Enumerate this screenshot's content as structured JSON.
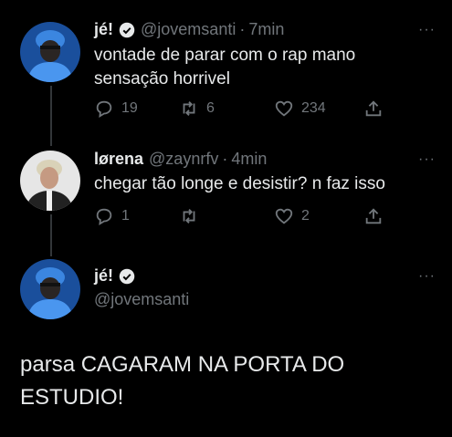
{
  "tweets": [
    {
      "display_name": "jé!",
      "handle": "@jovemsanti",
      "time": "7min",
      "text_line1": "vontade de parar com o rap mano",
      "text_line2": "sensação horrivel",
      "replies": "19",
      "retweets": "6",
      "likes": "234",
      "verified": true
    },
    {
      "display_name": "lørena",
      "handle": "@zaynrfv",
      "time": "4min",
      "text_line1": "chegar tão longe e desistir? n faz isso",
      "replies": "1",
      "retweets": "",
      "likes": "2",
      "verified": false
    }
  ],
  "focused_tweet": {
    "display_name": "jé!",
    "handle": "@jovemsanti",
    "text_line1": "parsa CAGARAM NA PORTA DO",
    "text_line2": "ESTUDIO!",
    "verified": true
  },
  "separator": "·",
  "more_glyph": "···",
  "colors": {
    "background": "#000000",
    "text": "#e7e9ea",
    "muted": "#71767b",
    "thread_line": "#333639",
    "avatar_blue": "#3a78c8"
  }
}
